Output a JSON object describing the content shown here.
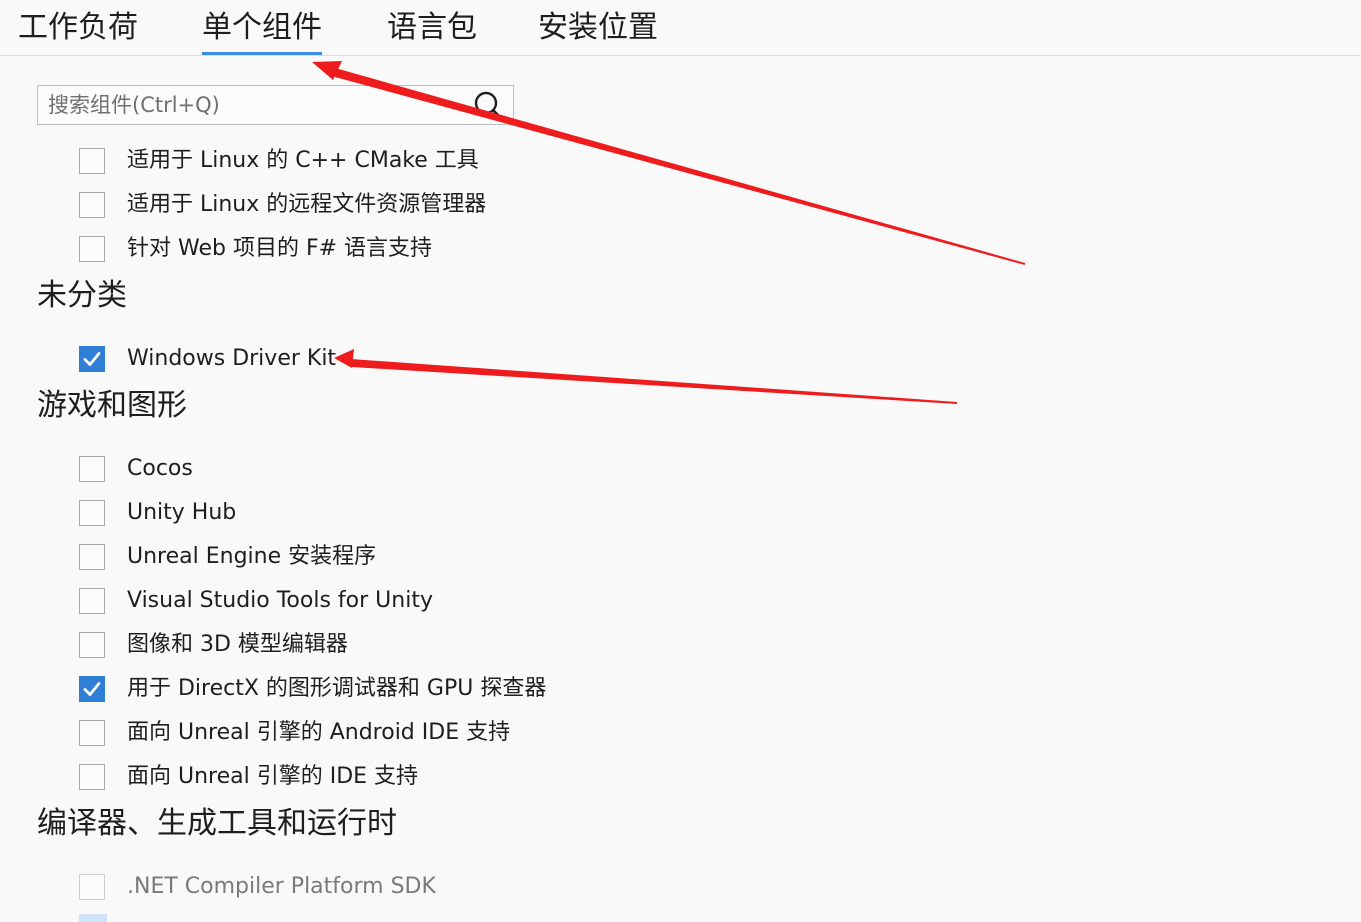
{
  "tabs": [
    {
      "label": "工作负荷",
      "active": false
    },
    {
      "label": "单个组件",
      "active": true
    },
    {
      "label": "语言包",
      "active": false
    },
    {
      "label": "安装位置",
      "active": false
    }
  ],
  "search": {
    "placeholder": "搜索组件(Ctrl+Q)",
    "value": "",
    "icon": "search-icon"
  },
  "linux_items": [
    {
      "label": "适用于 Linux 的 C++ CMake 工具",
      "checked": false
    },
    {
      "label": "适用于 Linux 的远程文件资源管理器",
      "checked": false
    },
    {
      "label": "针对 Web 项目的 F# 语言支持",
      "checked": false
    }
  ],
  "sections": {
    "uncategorized": {
      "title": "未分类",
      "items": [
        {
          "label": "Windows Driver Kit",
          "checked": true
        }
      ]
    },
    "games": {
      "title": "游戏和图形",
      "items": [
        {
          "label": "Cocos",
          "checked": false
        },
        {
          "label": "Unity Hub",
          "checked": false
        },
        {
          "label": "Unreal Engine 安装程序",
          "checked": false
        },
        {
          "label": "Visual Studio Tools for Unity",
          "checked": false
        },
        {
          "label": "图像和 3D 模型编辑器",
          "checked": false
        },
        {
          "label": "用于 DirectX 的图形调试器和 GPU 探查器",
          "checked": true
        },
        {
          "label": "面向 Unreal 引擎的 Android IDE 支持",
          "checked": false
        },
        {
          "label": "面向 Unreal 引擎的 IDE 支持",
          "checked": false
        }
      ]
    },
    "compilers": {
      "title": "编译器、生成工具和运行时",
      "items": [
        {
          "label": ".NET Compiler Platform SDK",
          "checked": false,
          "disabled": true
        }
      ]
    }
  },
  "colors": {
    "accent": "#2f7fd6",
    "tab_underline": "#3c8ce6",
    "annotation_arrow": "#ee1c1c",
    "background": "#f9f9fa"
  }
}
